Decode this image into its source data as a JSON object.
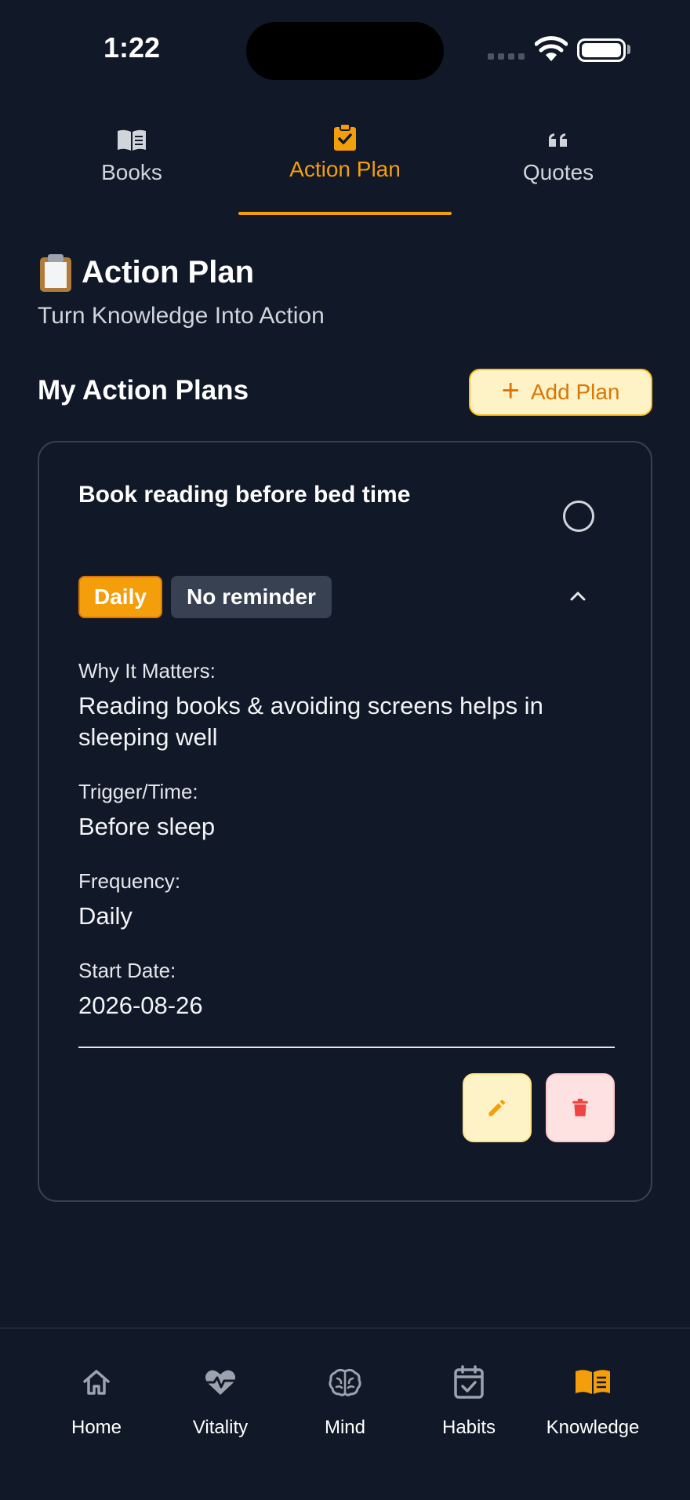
{
  "status_bar": {
    "time": "1:22"
  },
  "top_tabs": [
    {
      "label": "Books",
      "icon": "book-open-icon",
      "active": false
    },
    {
      "label": "Action Plan",
      "icon": "clipboard-check-icon",
      "active": true
    },
    {
      "label": "Quotes",
      "icon": "quote-icon",
      "active": false
    }
  ],
  "header": {
    "icon": "clipboard-emoji-icon",
    "title": "Action Plan",
    "subtitle": "Turn Knowledge Into Action"
  },
  "section": {
    "title": "My Action Plans",
    "add_label": "Add Plan"
  },
  "plan": {
    "title": "Book reading before bed time",
    "frequency_badge": "Daily",
    "reminder_badge": "No reminder",
    "fields": [
      {
        "label": "Why It Matters:",
        "value": "Reading books & avoiding screens helps in sleeping well"
      },
      {
        "label": "Trigger/Time:",
        "value": "Before sleep"
      },
      {
        "label": "Frequency:",
        "value": "Daily"
      },
      {
        "label": "Start Date:",
        "value": "2026-08-26"
      }
    ]
  },
  "bottom_nav": [
    {
      "label": "Home",
      "icon": "home-icon",
      "active": false
    },
    {
      "label": "Vitality",
      "icon": "heart-pulse-icon",
      "active": false
    },
    {
      "label": "Mind",
      "icon": "brain-icon",
      "active": false
    },
    {
      "label": "Habits",
      "icon": "calendar-check-icon",
      "active": false
    },
    {
      "label": "Knowledge",
      "icon": "book-open-icon",
      "active": true
    }
  ],
  "colors": {
    "background": "#111827",
    "accent": "#f59e0b",
    "danger": "#ef4444",
    "muted": "#d1d5db"
  }
}
